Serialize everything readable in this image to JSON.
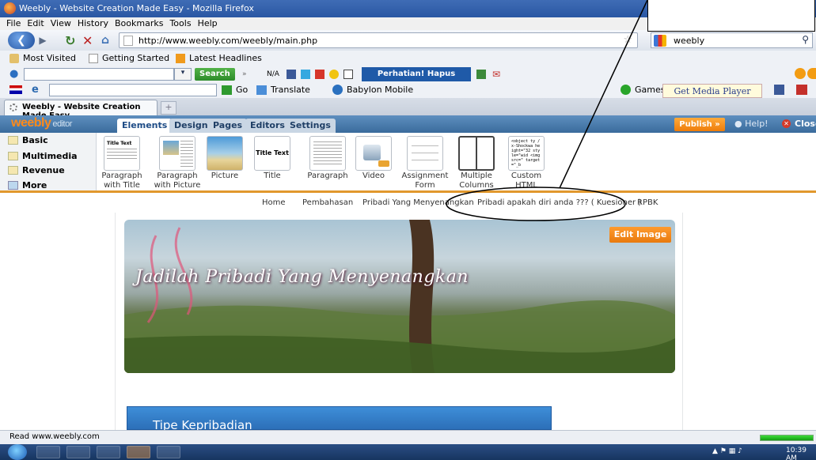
{
  "window": {
    "title": "Weebly - Website Creation Made Easy - Mozilla Firefox"
  },
  "menu": [
    "File",
    "Edit",
    "View",
    "History",
    "Bookmarks",
    "Tools",
    "Help"
  ],
  "nav": {
    "url": "http://www.weebly.com/weebly/main.php",
    "search_value": "weebly"
  },
  "bookmarks": [
    "Most Visited",
    "Getting Started",
    "Latest Headlines"
  ],
  "toolbar1": {
    "search_label": "Search",
    "na_label": "N/A",
    "spyware_label": "Perhatian! Hapus Spyware"
  },
  "toolbar2": {
    "go_label": "Go",
    "translate_label": "Translate",
    "babylon_label": "Babylon Mobile",
    "games_label": "Games",
    "media_plugin_label": "Get Media Player Plugin"
  },
  "tabs": {
    "active_label": "Weebly - Website Creation Made Easy",
    "new_tab": "+"
  },
  "weebly": {
    "logo": "weebly",
    "logo_sub": "editor",
    "tabs": [
      "Elements",
      "Design",
      "Pages",
      "Editors",
      "Settings"
    ],
    "publish_label": "Publish »",
    "help_label": "Help!",
    "close_label": "Close"
  },
  "categories": [
    "Basic",
    "Multimedia",
    "Revenue",
    "More"
  ],
  "elements": [
    {
      "label1": "Paragraph",
      "label2": "with Title"
    },
    {
      "label1": "Paragraph",
      "label2": "with Picture"
    },
    {
      "label1": "Picture",
      "label2": ""
    },
    {
      "label1": "Title",
      "label2": ""
    },
    {
      "label1": "Paragraph",
      "label2": ""
    },
    {
      "label1": "Video",
      "label2": ""
    },
    {
      "label1": "Assignment",
      "label2": "Form"
    },
    {
      "label1": "Multiple",
      "label2": "Columns"
    },
    {
      "label1": "Custom",
      "label2": "HTML"
    }
  ],
  "element_thumbs": {
    "title_text": "Title Text",
    "custom_html_code": "<object ty /x-Shockwa height=\"32 style=\"wid <img src=\" target=\"_b"
  },
  "site_nav": [
    "Home",
    "Pembahasan",
    "Pribadi Yang Menyenangkan",
    "Pribadi apakah diri anda ??? ( Kuesioner )",
    "RPBK"
  ],
  "banner": {
    "text": "Jadilah Pribadi Yang Menyenangkan",
    "edit_label": "Edit Image"
  },
  "content": {
    "section_title": "Tipe Kepribadian"
  },
  "status": {
    "text": "Read www.weebly.com"
  },
  "taskbar": {
    "clock": "10:39 AM"
  }
}
